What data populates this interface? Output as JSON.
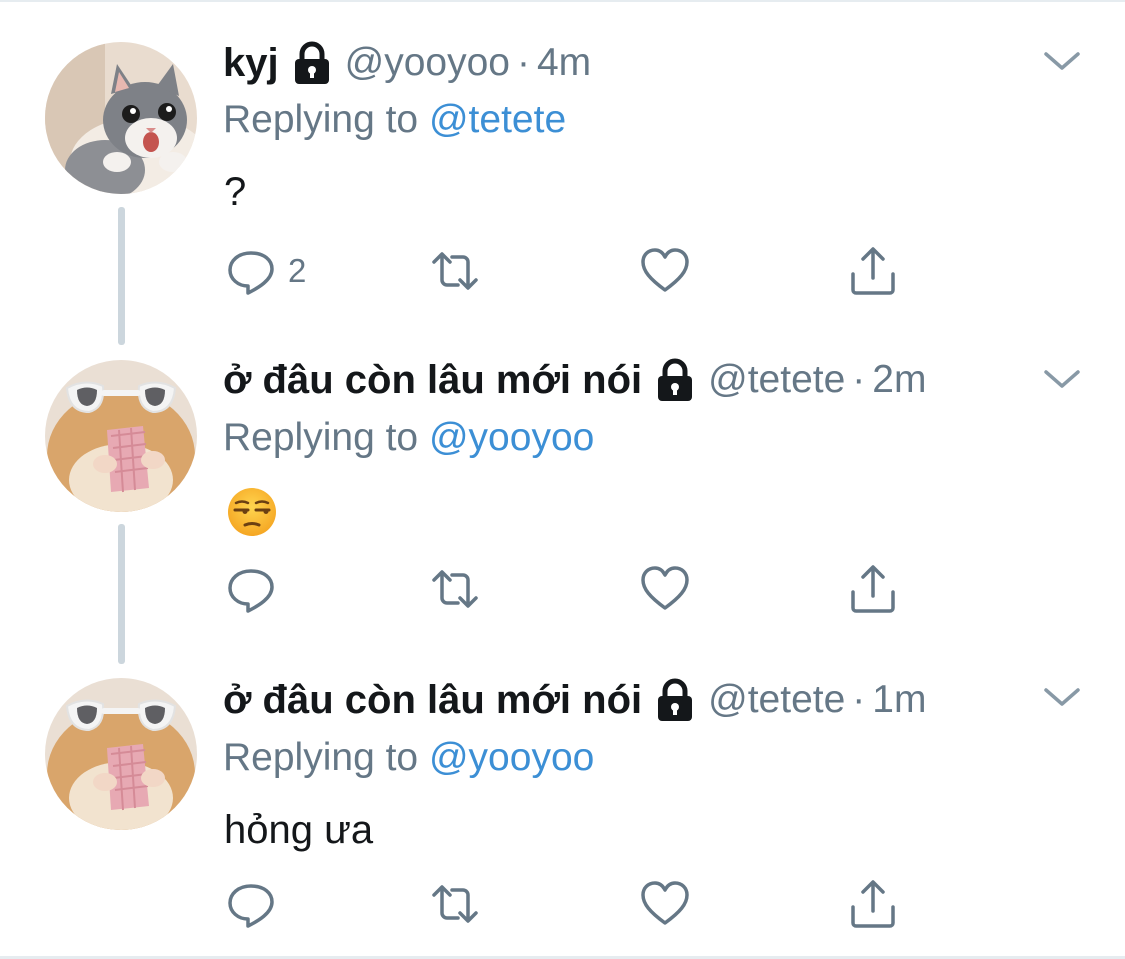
{
  "tweets": [
    {
      "display_name": "kyj",
      "handle": "@yooyoo",
      "dot": "·",
      "time": "4m",
      "replying_prefix": "Replying to",
      "replying_handle": "@tetete",
      "text": "?",
      "reply_count": "2",
      "avatar": "cat-avatar"
    },
    {
      "display_name": "ở đâu còn lâu mới nói",
      "handle": "@tetete",
      "dot": "·",
      "time": "2m",
      "replying_prefix": "Replying to",
      "replying_handle": "@yooyoo",
      "emoji": "unamused-face-emoji",
      "reply_count": "",
      "avatar": "hamster-sunglasses-avatar"
    },
    {
      "display_name": "ở đâu còn lâu mới nói",
      "handle": "@tetete",
      "dot": "·",
      "time": "1m",
      "replying_prefix": "Replying to",
      "replying_handle": "@yooyoo",
      "text": "hỏng ưa",
      "reply_count": "",
      "avatar": "hamster-sunglasses-avatar"
    }
  ],
  "icons": [
    "lock-icon",
    "chevron-down-icon",
    "reply-icon",
    "retweet-icon",
    "like-icon",
    "share-icon"
  ],
  "colors": {
    "text": "#14171a",
    "secondary": "#657786",
    "link": "#3c8fd5",
    "thread_line": "#ccd6dd"
  }
}
